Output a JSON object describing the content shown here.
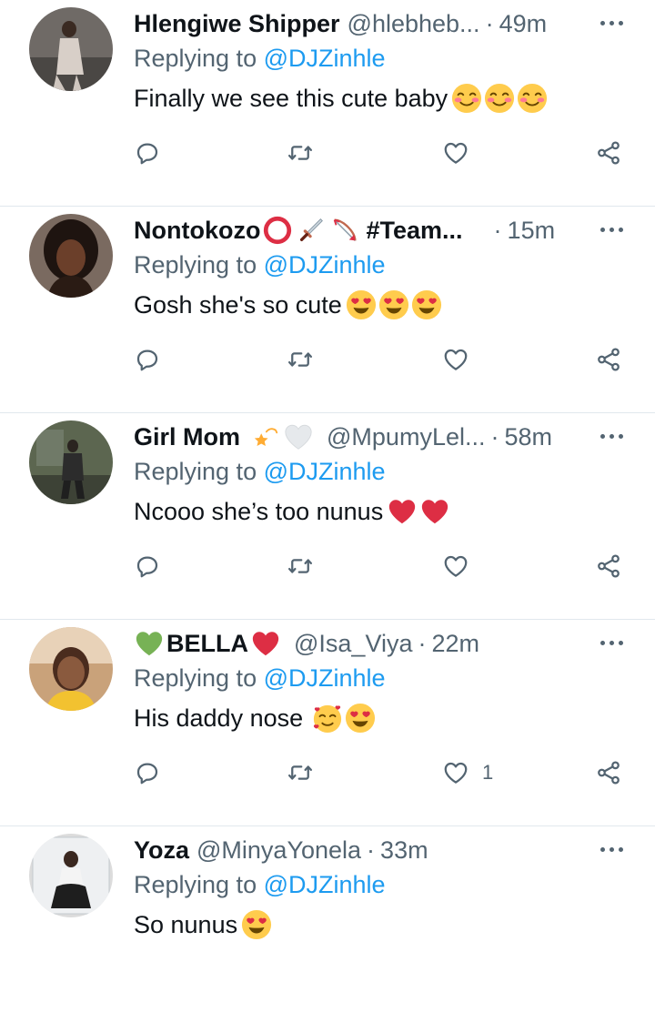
{
  "tweets": [
    {
      "name": "Hlengiwe Shipper",
      "badges": [],
      "handle": "@hlebheb...",
      "separator": "·",
      "time": "49m",
      "replying_prefix": "Replying to ",
      "replying_to": "@DJZinhle",
      "text": "Finally we see this cute baby",
      "emojis": [
        "smiling-blush-emoji",
        "smiling-blush-emoji",
        "smiling-blush-emoji"
      ],
      "like_count": ""
    },
    {
      "name": "Nontokozo",
      "name_suffix": "#Team...",
      "badges": [
        "red-circle-emoji",
        "dagger-emoji",
        "bow-arrow-emoji"
      ],
      "handle": "",
      "separator": "·",
      "time": "15m",
      "replying_prefix": "Replying to ",
      "replying_to": "@DJZinhle",
      "text": "Gosh she's so cute",
      "emojis": [
        "heart-eyes-emoji",
        "heart-eyes-emoji",
        "heart-eyes-emoji"
      ],
      "like_count": ""
    },
    {
      "name": "Girl Mom",
      "badges": [
        "dizzy-star-emoji",
        "white-heart-emoji"
      ],
      "handle": "@MpumyLel...",
      "separator": "·",
      "time": "58m",
      "replying_prefix": "Replying to ",
      "replying_to": "@DJZinhle",
      "text": "Ncooo she’s too nunus",
      "emojis": [
        "red-heart-emoji",
        "red-heart-emoji"
      ],
      "like_count": ""
    },
    {
      "name": "BELLA",
      "badges_before": [
        "green-heart-emoji"
      ],
      "badges": [
        "red-heart-emoji"
      ],
      "handle": "@Isa_Viya",
      "separator": "·",
      "time": "22m",
      "replying_prefix": "Replying to ",
      "replying_to": "@DJZinhle",
      "text": "His daddy nose",
      "emojis": [
        "smiling-hearts-emoji",
        "heart-eyes-emoji"
      ],
      "like_count": "1"
    },
    {
      "name": "Yoza",
      "badges": [],
      "handle": "@MinyaYonela",
      "separator": "·",
      "time": "33m",
      "replying_prefix": "Replying to ",
      "replying_to": "@DJZinhle",
      "text": "So nunus",
      "emojis": [
        "heart-eyes-emoji"
      ],
      "like_count": ""
    }
  ],
  "colors": {
    "text": "#0f1419",
    "secondary": "#536471",
    "link": "#1d9bf0",
    "divider": "#e1e8ed"
  }
}
